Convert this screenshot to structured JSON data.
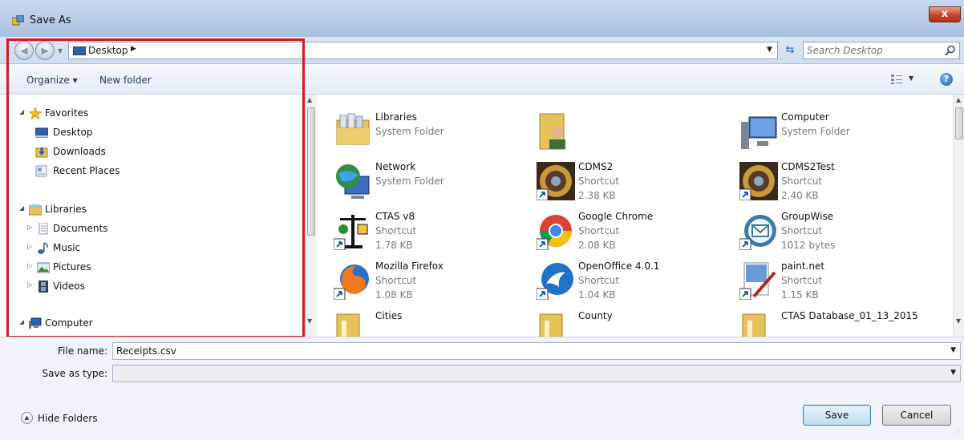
{
  "window": {
    "title": "Save As",
    "close_label": "x"
  },
  "address_bar": {
    "crumb": "Desktop",
    "search_placeholder": "Search Desktop"
  },
  "toolbar": {
    "organize_label": "Organize",
    "new_folder_label": "New folder"
  },
  "nav_tree": {
    "favorites": "Favorites",
    "desktop": "Desktop",
    "downloads": "Downloads",
    "recent_places": "Recent Places",
    "libraries": "Libraries",
    "documents": "Documents",
    "music": "Music",
    "pictures": "Pictures",
    "videos": "Videos",
    "computer": "Computer"
  },
  "files": [
    {
      "name": "Libraries",
      "sub": "System Folder",
      "size": "",
      "icon": "libraries-icon"
    },
    {
      "name": "",
      "sub": "",
      "size": "",
      "icon": "user-folder-icon"
    },
    {
      "name": "Computer",
      "sub": "System Folder",
      "size": "",
      "icon": "computer-icon"
    },
    {
      "name": "Network",
      "sub": "System Folder",
      "size": "",
      "icon": "network-globe-icon"
    },
    {
      "name": "CDMS2",
      "sub": "Shortcut",
      "size": "2.38 KB",
      "icon": "seal-shortcut-icon"
    },
    {
      "name": "CDMS2Test",
      "sub": "Shortcut",
      "size": "2.40 KB",
      "icon": "seal-shortcut-icon"
    },
    {
      "name": "CTAS v8",
      "sub": "Shortcut",
      "size": "1.78 KB",
      "icon": "scales-shortcut-icon"
    },
    {
      "name": "Google Chrome",
      "sub": "Shortcut",
      "size": "2.08 KB",
      "icon": "chrome-shortcut-icon"
    },
    {
      "name": "GroupWise",
      "sub": "Shortcut",
      "size": "1012 bytes",
      "icon": "groupwise-shortcut-icon"
    },
    {
      "name": "Mozilla Firefox",
      "sub": "Shortcut",
      "size": "1.08 KB",
      "icon": "firefox-shortcut-icon"
    },
    {
      "name": "OpenOffice 4.0.1",
      "sub": "Shortcut",
      "size": "1.04 KB",
      "icon": "openoffice-shortcut-icon"
    },
    {
      "name": "paint.net",
      "sub": "Shortcut",
      "size": "1.15 KB",
      "icon": "paintnet-shortcut-icon"
    },
    {
      "name": "Cities",
      "sub": "",
      "size": "",
      "icon": "folder-icon"
    },
    {
      "name": "County",
      "sub": "",
      "size": "",
      "icon": "folder-icon"
    },
    {
      "name": "CTAS Database_01_13_2015",
      "sub": "",
      "size": "",
      "icon": "folder-icon"
    }
  ],
  "form": {
    "file_name_label": "File name:",
    "file_name_value": "Receipts.csv",
    "save_type_label": "Save as type:",
    "save_type_value": "",
    "hide_folders_label": "Hide Folders",
    "save_label": "Save",
    "cancel_label": "Cancel"
  },
  "colors": {
    "highlight_border": "#e0141e",
    "accent": "#1d5cb6"
  }
}
